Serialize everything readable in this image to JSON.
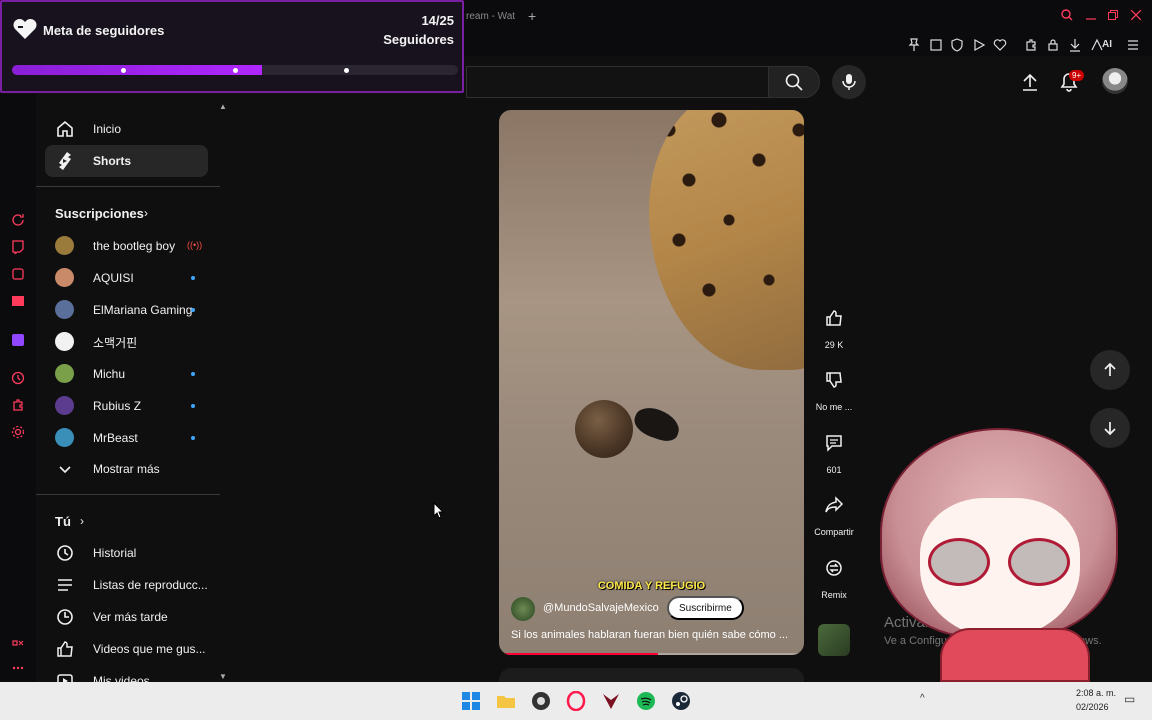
{
  "browser": {
    "tab_title": "ream - Wat",
    "new_tab": "+",
    "ai_label": "AI",
    "colors": {
      "accent": "#ff3b5c"
    }
  },
  "goal_overlay": {
    "title": "Meta de seguidores",
    "count": "14/25",
    "subtitle": "Seguidores",
    "progress_fraction": 0.56,
    "milestones": [
      0.25,
      0.5,
      0.75
    ],
    "colors": {
      "fill": "#b026ff",
      "border": "#7b1fa2"
    }
  },
  "header": {
    "notifications_badge": "9+"
  },
  "sidebar": {
    "items": [
      {
        "label": "Inicio",
        "icon": "home-icon"
      },
      {
        "label": "Shorts",
        "icon": "shorts-icon",
        "active": true
      }
    ],
    "subscriptions_title": "Suscripciones",
    "subscriptions": [
      {
        "name": "the bootleg boy",
        "indicator": "live",
        "avatar_color": "#9a7b3c"
      },
      {
        "name": "AQUISI",
        "indicator": "dot",
        "avatar_color": "#c98a6a"
      },
      {
        "name": "ElMariana Gaming",
        "indicator": "dot",
        "avatar_color": "#5a6f9a"
      },
      {
        "name": "소맥거핀",
        "indicator": "none",
        "avatar_color": "#f2f2f2"
      },
      {
        "name": "Michu",
        "indicator": "dot",
        "avatar_color": "#7aa04a"
      },
      {
        "name": "Rubius Z",
        "indicator": "dot",
        "avatar_color": "#5b3c8f"
      },
      {
        "name": "MrBeast",
        "indicator": "dot",
        "avatar_color": "#3a8fb8"
      }
    ],
    "show_more": "Mostrar más",
    "you_title": "Tú",
    "you_items": [
      {
        "label": "Historial",
        "icon": "history-icon"
      },
      {
        "label": "Listas de reproducc...",
        "icon": "playlists-icon"
      },
      {
        "label": "Ver más tarde",
        "icon": "watch-later-icon"
      },
      {
        "label": "Videos que me gus...",
        "icon": "liked-icon"
      },
      {
        "label": "Mis videos",
        "icon": "my-videos-icon"
      }
    ]
  },
  "short": {
    "caption_overlay": "COMIDA Y REFUGIO",
    "channel": "@MundoSalvajeMexico",
    "subscribe_label": "Suscribirme",
    "description": "Si los animales hablaran fueran bien quién sabe cómo ...",
    "progress_fraction": 0.52
  },
  "actions": [
    {
      "label": "29 K",
      "icon": "like-icon"
    },
    {
      "label": "No me ...",
      "icon": "dislike-icon"
    },
    {
      "label": "601",
      "icon": "comment-icon"
    },
    {
      "label": "Compartir",
      "icon": "share-icon"
    },
    {
      "label": "Remix",
      "icon": "remix-icon"
    }
  ],
  "windows_watermark": {
    "title": "Activar W",
    "subtitle": "Ve a Configura",
    "subtitle_end": "Windows."
  },
  "taskbar": {
    "time": "2:08 a. m.",
    "date": "02/2026",
    "chevron": "^"
  }
}
